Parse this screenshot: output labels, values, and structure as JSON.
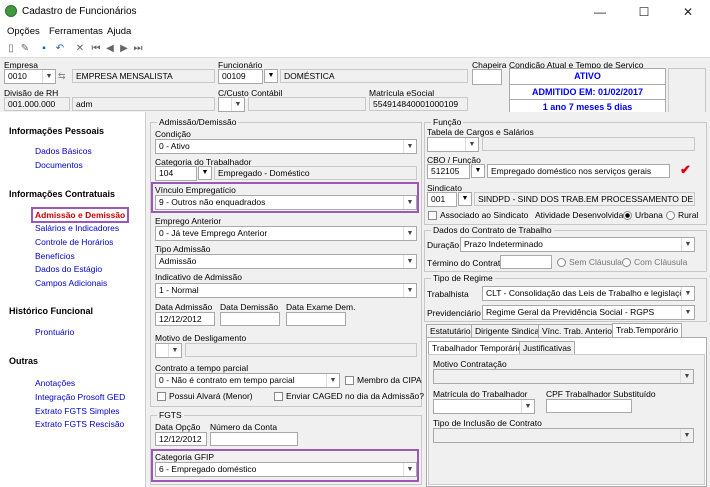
{
  "window": {
    "title": "Cadastro de Funcionários",
    "min": "—",
    "max": "☐",
    "close": "✕"
  },
  "menu": [
    "Opções",
    "Ferramentas",
    "Ajuda"
  ],
  "header": {
    "empresa_label": "Empresa",
    "empresa_code": "0010",
    "empresa_name": "EMPRESA MENSALISTA",
    "funcionario_label": "Funcionário",
    "funcionario_code": "00109",
    "funcionario_name": "DOMÉSTICA",
    "chapeira_label": "Chapeira",
    "chapeira_value": "",
    "condicao_label": "Condição Atual e Tempo de Serviço",
    "status_ativo": "ATIVO",
    "status_admitido": "ADMITIDO EM: 01/02/2017",
    "status_tempo": "1 ano 7 meses 5 dias",
    "divisao_label": "Divisão de RH",
    "divisao_code": "001.000.000",
    "divisao_name": "adm",
    "ccusto_label": "C/Custo Contábil",
    "ccusto_value": "",
    "matricula_label": "Matrícula eSocial",
    "matricula_value": "554914840001000109"
  },
  "nav": {
    "sec1": "Informações Pessoais",
    "s1": [
      "Dados Básicos",
      "Documentos"
    ],
    "sec2": "Informações Contratuais",
    "s2": [
      "Admissão e Demissão",
      "Salários e Indicadores",
      "Controle de Horários",
      "Benefícios",
      "Dados do Estágio",
      "Campos Adicionais"
    ],
    "sec3": "Histórico Funcional",
    "s3": [
      "Prontuário"
    ],
    "sec4": "Outras",
    "s4": [
      "Anotações",
      "Integração Prosoft GED",
      "Extrato FGTS Simples",
      "Extrato FGTS Rescisão"
    ]
  },
  "admissao": {
    "group": "Admissão/Demissão",
    "condicao_label": "Condição",
    "condicao_value": "0 - Ativo",
    "categoria_label": "Categoria do Trabalhador",
    "categoria_code": "104",
    "categoria_name": "Empregado - Doméstico",
    "vinculo_label": "Vínculo Empregatício",
    "vinculo_value": "9 - Outros não enquadrados",
    "empant_label": "Emprego Anterior",
    "empant_value": "0 - Já teve Emprego Anterior",
    "tipoadm_label": "Tipo Admissão",
    "tipoadm_value": "Admissão",
    "indic_label": "Indicativo de Admissão",
    "indic_value": "1 - Normal",
    "dataadm_label": "Data Admissão",
    "dataadm_value": "12/12/2012",
    "datadem_label": "Data Demissão",
    "dataexame_label": "Data Exame Dem.",
    "motivo_label": "Motivo de Desligamento",
    "contrato_label": "Contrato a tempo parcial",
    "contrato_value": "0 - Não é contrato em tempo parcial",
    "cipa_label": "Membro da CIPA",
    "alvara_label": "Possui Alvará (Menor)",
    "caged_label": "Enviar CAGED no dia da Admissão?"
  },
  "fgts": {
    "group": "FGTS",
    "dataopcao_label": "Data Opção",
    "dataopcao_value": "12/12/2012",
    "conta_label": "Número da Conta",
    "gfip_label": "Categoria GFIP",
    "gfip_value": "6 - Empregado doméstico"
  },
  "funcao": {
    "group": "Função",
    "tabela_label": "Tabela de Cargos e Salários",
    "cbo_label": "CBO / Função",
    "cbo_code": "512105",
    "cbo_name": "Empregado doméstico nos serviços gerais",
    "sindicato_label": "Sindicato",
    "sindicato_code": "001",
    "sindicato_name": "SINDPD - SIND DOS TRAB.EM PROCESSAMENTO DE DADOS EST",
    "associado_label": "Associado ao Sindicato",
    "atividade_label": "Atividade Desenvolvida:",
    "urbana_label": "Urbana",
    "rural_label": "Rural"
  },
  "contrato": {
    "group": "Dados do Contrato de Trabalho",
    "duracao_label": "Duração",
    "duracao_value": "Prazo Indeterminado",
    "termino_label": "Término do Contrato",
    "sem_label": "Sem Cláusula",
    "com_label": "Com Cláusula"
  },
  "regime": {
    "group": "Tipo de Regime",
    "trab_label": "Trabalhista",
    "trab_value": "CLT - Consolidação das Leis de Trabalho e legislações tra",
    "prev_label": "Previdenciário",
    "prev_value": "Regime Geral da Previdência Social - RGPS"
  },
  "tabs": [
    "Estatutário",
    "Dirigente Sindical",
    "Vínc. Trab. Anterior",
    "Trab.Temporário"
  ],
  "subtabs": [
    "Trabalhador Temporário",
    "Justificativas"
  ],
  "temp": {
    "motivo_label": "Motivo Contratação",
    "matricula_label": "Matrícula do Trabalhador",
    "cpf_label": "CPF Trabalhador Substituído",
    "tipoinc_label": "Tipo de Inclusão de Contrato"
  },
  "colors": {
    "accent_purple": "#9b59b6",
    "status_blue": "#0000ee",
    "nav_red": "#cc0000"
  }
}
